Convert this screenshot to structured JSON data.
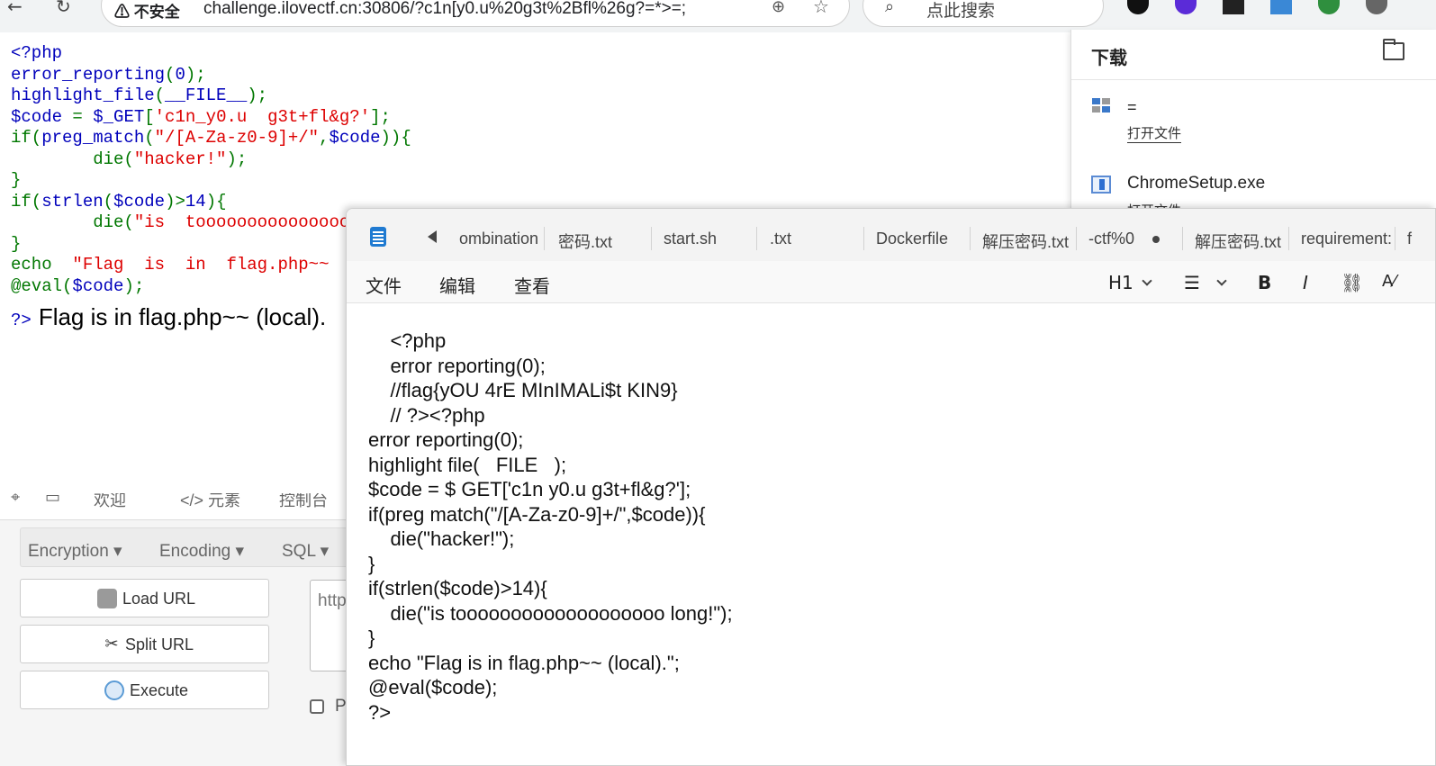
{
  "browser": {
    "security_label": "不安全",
    "url": "challenge.ilovectf.cn:30806/?c1n[y0.u%20g3t%2Bfl%26g?=*>=;",
    "search_placeholder": "点此搜索",
    "icons": [
      "back-icon",
      "reload-icon",
      "warning-icon",
      "zoom-icon",
      "star-icon",
      "search-icon",
      "extension-icon"
    ]
  },
  "php_source": [
    [
      {
        "c": "bl",
        "t": "<?php"
      }
    ],
    [
      {
        "c": "bl",
        "t": "error_reporting"
      },
      {
        "c": "gr",
        "t": "("
      },
      {
        "c": "bl",
        "t": "0"
      },
      {
        "c": "gr",
        "t": ");"
      }
    ],
    [
      {
        "c": "bl",
        "t": "highlight_file"
      },
      {
        "c": "gr",
        "t": "("
      },
      {
        "c": "bl",
        "t": "__FILE__"
      },
      {
        "c": "gr",
        "t": ");"
      }
    ],
    [
      {
        "c": "bl",
        "t": "$code "
      },
      {
        "c": "gr",
        "t": "= "
      },
      {
        "c": "bl",
        "t": "$_GET"
      },
      {
        "c": "gr",
        "t": "["
      },
      {
        "c": "rd",
        "t": "'c1n_y0.u  g3t+fl&g?'"
      },
      {
        "c": "gr",
        "t": "];"
      }
    ],
    [
      {
        "c": "gr",
        "t": "if("
      },
      {
        "c": "bl",
        "t": "preg_match"
      },
      {
        "c": "gr",
        "t": "("
      },
      {
        "c": "rd",
        "t": "\"/[A-Za-z0-9]+/\""
      },
      {
        "c": "gr",
        "t": ","
      },
      {
        "c": "bl",
        "t": "$code"
      },
      {
        "c": "gr",
        "t": ")){"
      }
    ],
    [
      {
        "c": "gr",
        "t": "        die("
      },
      {
        "c": "rd",
        "t": "\"hacker!\""
      },
      {
        "c": "gr",
        "t": ");"
      }
    ],
    [
      {
        "c": "gr",
        "t": "}"
      }
    ],
    [
      {
        "c": "gr",
        "t": "if("
      },
      {
        "c": "bl",
        "t": "strlen"
      },
      {
        "c": "gr",
        "t": "("
      },
      {
        "c": "bl",
        "t": "$code"
      },
      {
        "c": "gr",
        "t": ")>"
      },
      {
        "c": "bl",
        "t": "14"
      },
      {
        "c": "gr",
        "t": "){"
      }
    ],
    [
      {
        "c": "gr",
        "t": "        die("
      },
      {
        "c": "rd",
        "t": "\"is  tooooooooooooooooooo"
      }
    ],
    [
      {
        "c": "gr",
        "t": "}"
      }
    ],
    [
      {
        "c": "gr",
        "t": "echo  "
      },
      {
        "c": "rd",
        "t": "\"Flag  is  in  flag.php~~  (lo"
      }
    ],
    [
      {
        "c": "gr",
        "t": "@eval("
      },
      {
        "c": "bl",
        "t": "$code"
      },
      {
        "c": "gr",
        "t": ");"
      }
    ]
  ],
  "php_output": {
    "tag": "?>",
    "message": "Flag is in flag.php~~ (local)."
  },
  "devtools": {
    "tabs": [
      "欢迎",
      "</> 元素",
      "控制台"
    ]
  },
  "hackbar": {
    "menus": [
      "Encryption",
      "Encoding",
      "SQL"
    ],
    "buttons": [
      "Load URL",
      "Split URL",
      "Execute"
    ],
    "url_value": "http",
    "check_label": "P"
  },
  "downloads": {
    "title": "下载",
    "items": [
      {
        "name": "=",
        "action": "打开文件"
      },
      {
        "name": "ChromeSetup.exe",
        "action": "打开文件"
      }
    ]
  },
  "notepad": {
    "tabs": [
      "ombination",
      "密码.txt",
      "start.sh",
      ".txt",
      "Dockerfile",
      "解压密码.txt",
      "-ctf%0",
      "解压密码.txt",
      "requirement:",
      "f"
    ],
    "menu": [
      "文件",
      "编辑",
      "查看"
    ],
    "toolbar": {
      "heading": "H1",
      "bold": "B",
      "italic": "I"
    },
    "content": [
      "    <?php",
      "    error reporting(0);",
      "    //flag{yOU 4rE MInIMALi$t KIN9}",
      "    // ?><?php",
      "error reporting(0);",
      "highlight file(   FILE   );",
      "$code = $ GET['c1n y0.u g3t+fl&g?'];",
      "if(preg match(\"/[A-Za-z0-9]+/\",$code)){",
      "    die(\"hacker!\");",
      "}",
      "if(strlen($code)>14){",
      "    die(\"is tooooooooooooooooooo long!\");",
      "}",
      "echo \"Flag is in flag.php~~ (local).\";",
      "@eval($code);",
      "?>"
    ]
  }
}
